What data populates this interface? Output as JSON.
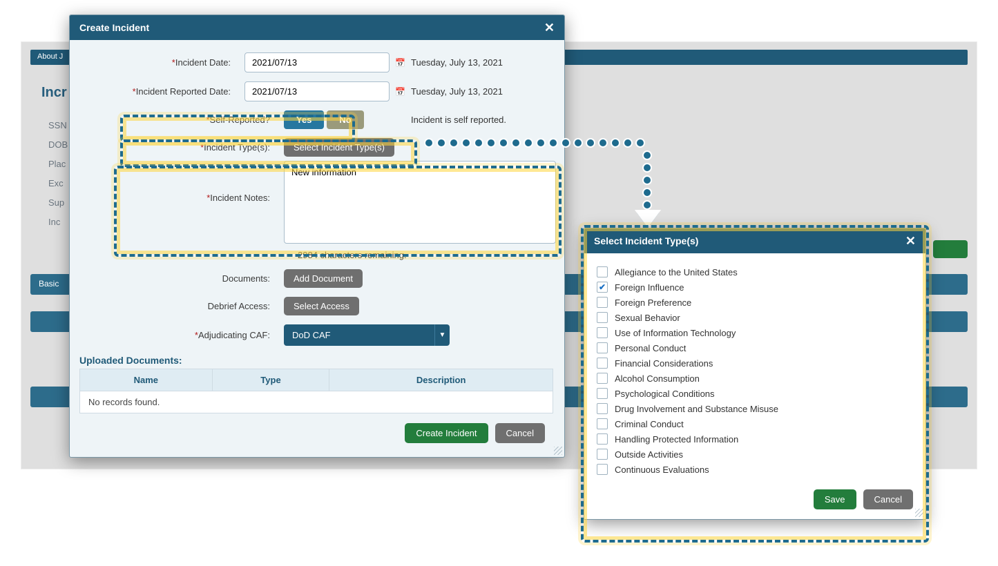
{
  "background": {
    "menu_item": "About J",
    "page_title_prefix": "Incr",
    "side_labels": [
      "SSN",
      "DOB",
      "Plac",
      "Exc",
      "Sup",
      "Inc"
    ],
    "tab_prefix": "Basic"
  },
  "modal": {
    "title": "Create Incident",
    "rows": {
      "incident_date": {
        "label": "Incident Date:",
        "value": "2021/07/13",
        "readout": "Tuesday, July 13, 2021"
      },
      "reported_date": {
        "label": "Incident Reported Date:",
        "value": "2021/07/13",
        "readout": "Tuesday, July 13, 2021"
      },
      "self_reported": {
        "label": "Self-Reported?",
        "yes": "Yes",
        "no": "No",
        "readout": "Incident is self reported."
      },
      "incident_types": {
        "label": "Incident Type(s):",
        "button": "Select Incident Type(s)"
      },
      "notes": {
        "label": "Incident Notes:",
        "value": "New information",
        "remaining": "2984 characters remaining."
      },
      "documents": {
        "label": "Documents:",
        "button": "Add Document"
      },
      "debrief": {
        "label": "Debrief Access:",
        "button": "Select Access"
      },
      "caf": {
        "label": "Adjudicating CAF:",
        "value": "DoD CAF"
      }
    },
    "uploaded_title": "Uploaded Documents:",
    "table": {
      "headers": [
        "Name",
        "Type",
        "Description"
      ],
      "empty": "No records found."
    },
    "footer": {
      "submit": "Create Incident",
      "cancel": "Cancel"
    }
  },
  "types_modal": {
    "title": "Select Incident Type(s)",
    "items": [
      {
        "label": "Allegiance to the United States",
        "checked": false
      },
      {
        "label": "Foreign Influence",
        "checked": true
      },
      {
        "label": "Foreign Preference",
        "checked": false
      },
      {
        "label": "Sexual Behavior",
        "checked": false
      },
      {
        "label": "Use of Information Technology",
        "checked": false
      },
      {
        "label": "Personal Conduct",
        "checked": false
      },
      {
        "label": "Financial Considerations",
        "checked": false
      },
      {
        "label": "Alcohol Consumption",
        "checked": false
      },
      {
        "label": "Psychological Conditions",
        "checked": false
      },
      {
        "label": "Drug Involvement and Substance Misuse",
        "checked": false
      },
      {
        "label": "Criminal Conduct",
        "checked": false
      },
      {
        "label": "Handling Protected Information",
        "checked": false
      },
      {
        "label": "Outside Activities",
        "checked": false
      },
      {
        "label": "Continuous Evaluations",
        "checked": false
      }
    ],
    "footer": {
      "save": "Save",
      "cancel": "Cancel"
    }
  }
}
